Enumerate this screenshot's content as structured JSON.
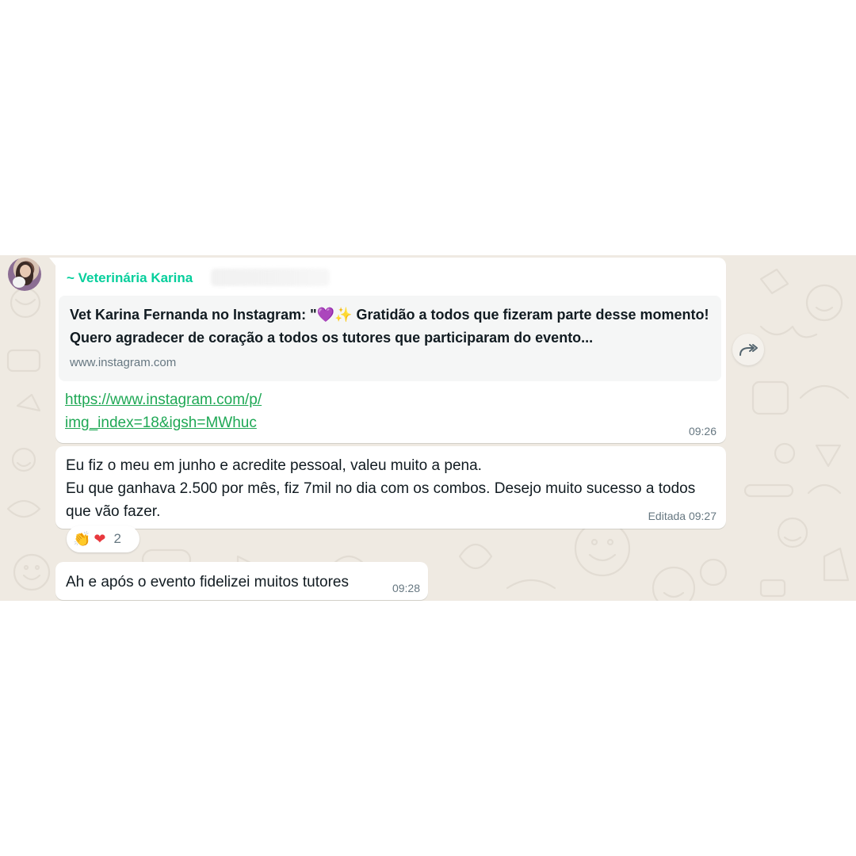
{
  "message1": {
    "sender": "~ Veterinária Karina",
    "preview_title_before": "Vet Karina Fernanda no Instagram: \"",
    "preview_emoji": "💜✨",
    "preview_title_after": " Gratidão a todos que fizeram parte desse momento! Quero agradecer de coração a todos os tutores que participaram do evento...",
    "preview_domain": "www.instagram.com",
    "link_line1": "https://www.instagram.com/p/",
    "link_line2": "img_index=18&igsh=MWhuc",
    "time": "09:26"
  },
  "message2": {
    "line1": "Eu fiz o meu em junho e acredite pessoal, valeu muito a pena.",
    "line2": "Eu que ganhava 2.500 por mês, fiz 7mil no dia com os combos. Desejo muito sucesso a todos que vão fazer.",
    "time": "Editada 09:27"
  },
  "reactions": {
    "emoji1": "👏",
    "emoji2": "❤",
    "count": "2"
  },
  "message3": {
    "text": "Ah e após o evento fidelizei muitos tutores",
    "time": "09:28"
  },
  "colors": {
    "chat_background": "#efeae2",
    "sender_name": "#06cf9c",
    "link": "#1fa855",
    "meta_text": "#667781"
  },
  "icons": {
    "forward": "forward-icon"
  }
}
